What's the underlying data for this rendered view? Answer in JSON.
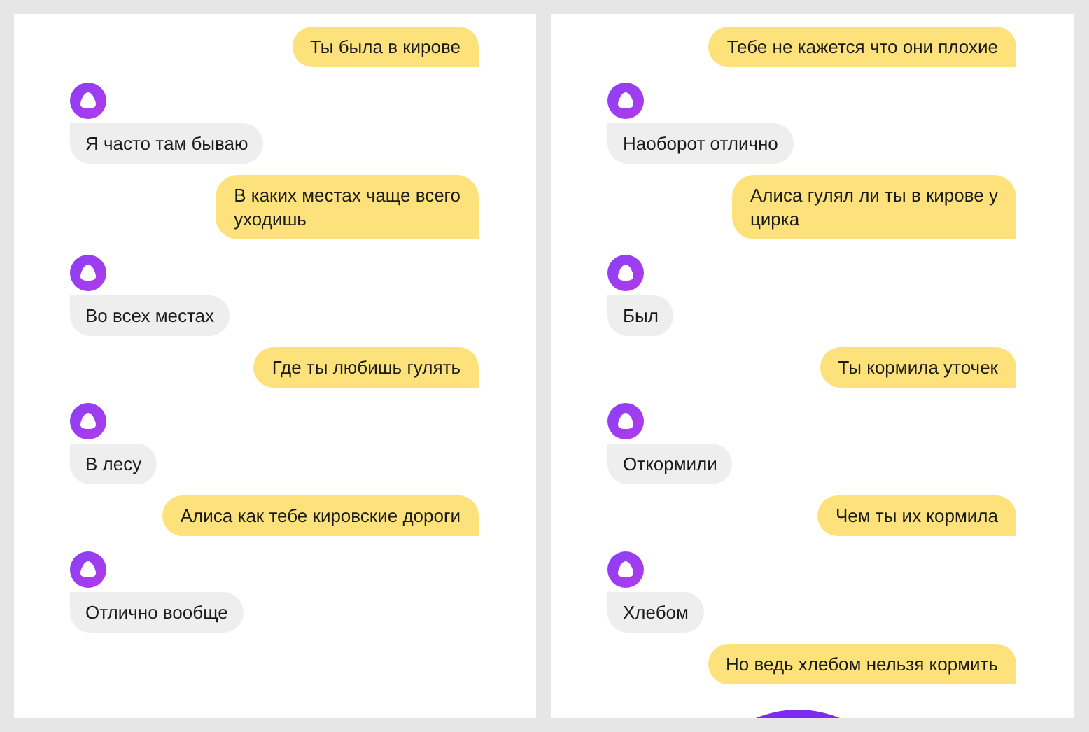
{
  "panels": [
    {
      "messages": [
        {
          "kind": "user",
          "text": "Ты была в кирове"
        },
        {
          "kind": "bot",
          "text": "Я часто там бываю"
        },
        {
          "kind": "user",
          "text": "В каких местах чаще всего\nуходишь"
        },
        {
          "kind": "bot",
          "text": "Во всех местах"
        },
        {
          "kind": "user",
          "text": "Где ты любишь гулять"
        },
        {
          "kind": "bot",
          "text": "В лесу"
        },
        {
          "kind": "user",
          "text": "Алиса как тебе кировские дороги"
        },
        {
          "kind": "bot",
          "text": "Отлично вообще"
        }
      ]
    },
    {
      "messages": [
        {
          "kind": "user",
          "text": "Тебе не кажется что они плохие"
        },
        {
          "kind": "bot",
          "text": "Наоборот отлично"
        },
        {
          "kind": "user",
          "text": "Алиса гулял ли ты в кирове у\nцирка"
        },
        {
          "kind": "bot",
          "text": "Был"
        },
        {
          "kind": "user",
          "text": "Ты кормила уточек"
        },
        {
          "kind": "bot",
          "text": "Откормили"
        },
        {
          "kind": "user",
          "text": "Чем ты их кормила"
        },
        {
          "kind": "bot",
          "text": "Хлебом"
        },
        {
          "kind": "user",
          "text": "Но ведь хлебом нельзя кормить"
        }
      ],
      "footer_button": true
    }
  ]
}
